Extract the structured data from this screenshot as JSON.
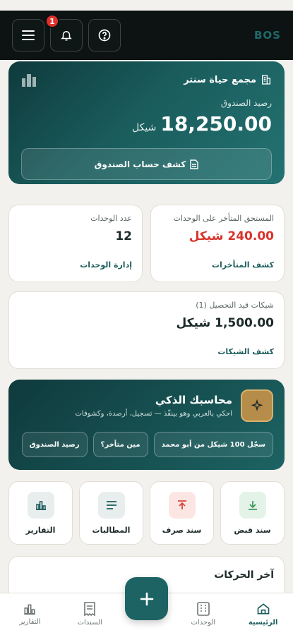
{
  "header": {
    "brand": "BOS",
    "notification_count": "1"
  },
  "hero": {
    "complex_name": "مجمع حياة سنتر",
    "balance_label": "رصيد الصندوق",
    "balance_value": "18,250.00",
    "currency": "شيكل",
    "statement_button": "كشف حساب الصندوق"
  },
  "overdue_card": {
    "label": "المستحق المتأخر على الوحدات",
    "value": "240.00 شيكل",
    "link": "كشف المتأخرات"
  },
  "units_card": {
    "label": "عدد الوحدات",
    "value": "12",
    "link": "إدارة الوحدات"
  },
  "cheques_card": {
    "label": "شيكات قيد التحصيل (1)",
    "value": "1,500.00 شيكل",
    "link": "كشف الشيكات"
  },
  "assistant": {
    "title": "محاسبك الذكي",
    "subtitle": "احكي بالعربي وهو بينفّذ — تسجيل، أرصدة، وكشوفات",
    "chips": [
      "سجّل 100 شيكل من أبو محمد",
      "مين متأخر؟",
      "رصيد الصندوق"
    ]
  },
  "quick_actions": [
    {
      "label": "سند قبض",
      "icon": "download-arrow-icon",
      "color": "#3c9a58",
      "bg": "#e4f3e8"
    },
    {
      "label": "سند صرف",
      "icon": "upload-arrow-icon",
      "color": "#d9443b",
      "bg": "#fbe6e4"
    },
    {
      "label": "المطالبات",
      "icon": "lines-icon",
      "color": "#1d5d5d",
      "bg": "#e8eeed"
    },
    {
      "label": "التقارير",
      "icon": "bar-chart-icon",
      "color": "#1d5d5d",
      "bg": "#e8eeed"
    }
  ],
  "recent": {
    "title": "آخر الحركات"
  },
  "bottom_nav": [
    {
      "label": "الرئيسية",
      "active": true
    },
    {
      "label": "الوحدات",
      "active": false
    },
    {
      "label": "السندات",
      "active": false
    },
    {
      "label": "التقارير",
      "active": false
    }
  ],
  "colors": {
    "accent": "#1d5d5d",
    "danger": "#d8332b",
    "gold": "#b68c4a"
  }
}
